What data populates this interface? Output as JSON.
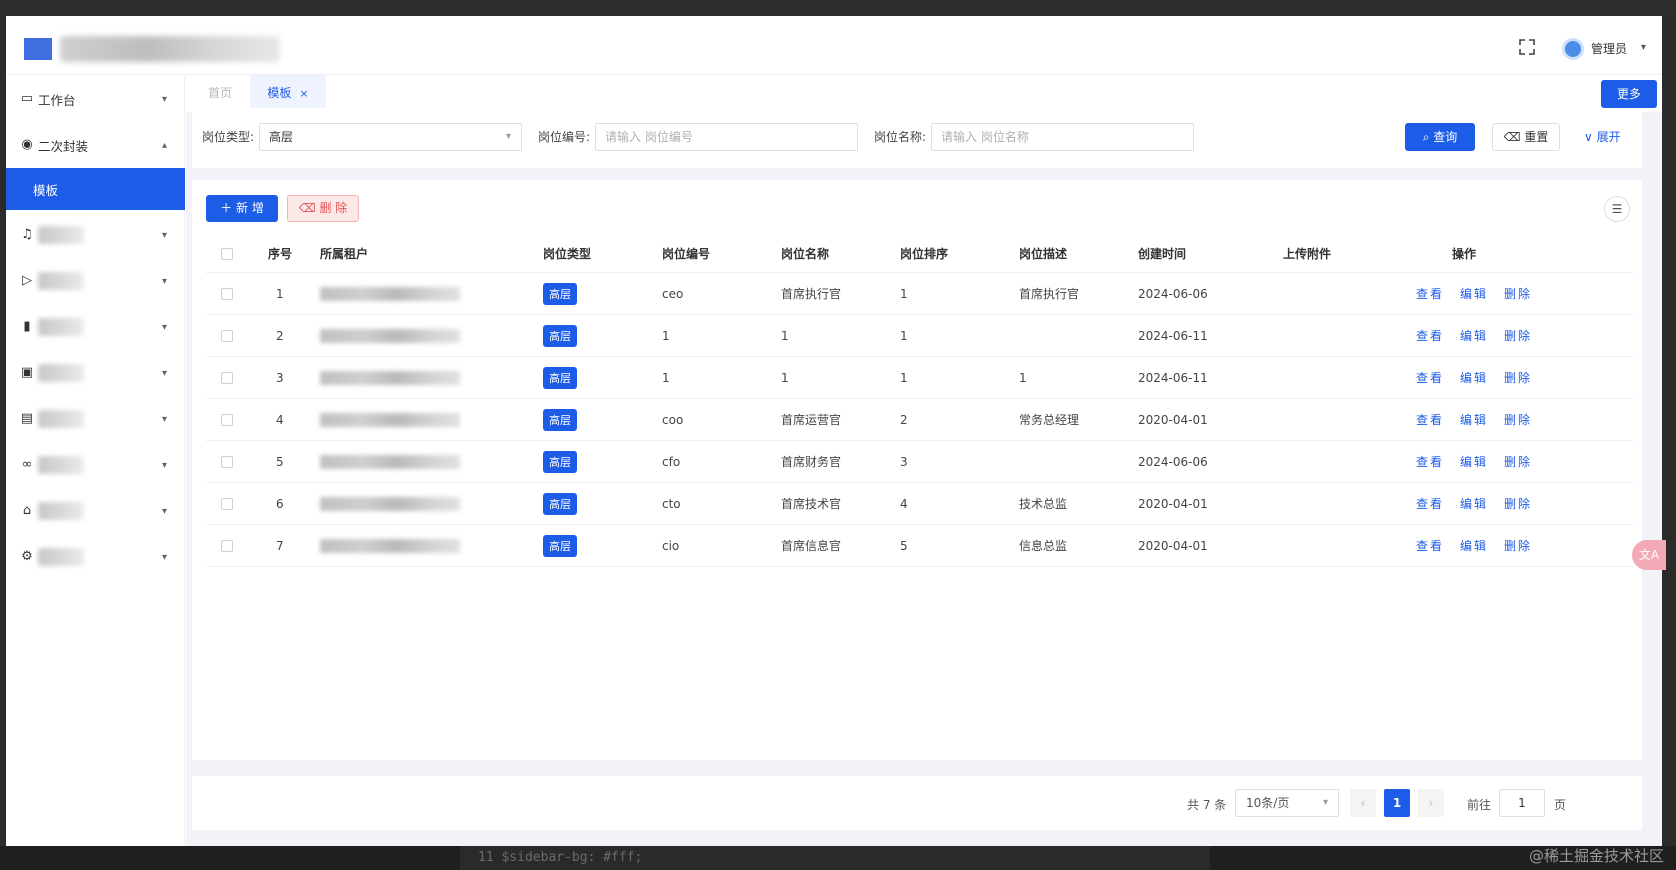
{
  "header": {
    "user_name": "管理员"
  },
  "sidebar": {
    "items": [
      {
        "label": "工作台",
        "icon": "monitor-icon"
      },
      {
        "label": "二次封装",
        "icon": "gauge-icon"
      },
      {
        "label": "模板"
      },
      {
        "icon": "bell-icon"
      },
      {
        "icon": "send-icon"
      },
      {
        "icon": "bar-chart-icon"
      },
      {
        "icon": "wallet-icon"
      },
      {
        "icon": "document-icon"
      },
      {
        "icon": "link-icon"
      },
      {
        "icon": "lock-icon"
      },
      {
        "icon": "gear-icon"
      }
    ]
  },
  "tabs": {
    "home": "首页",
    "current": "模板",
    "close": "×",
    "more": "更多"
  },
  "search": {
    "type_label": "岗位类型:",
    "type_value": "高层",
    "code_label": "岗位编号:",
    "code_placeholder": "请输入 岗位编号",
    "name_label": "岗位名称:",
    "name_placeholder": "请输入 岗位名称",
    "query": "查询",
    "reset": "重置",
    "expand": "展开"
  },
  "toolbar": {
    "add": "新 增",
    "delete": "删 除"
  },
  "table": {
    "headers": [
      "序号",
      "所属租户",
      "岗位类型",
      "岗位编号",
      "岗位名称",
      "岗位排序",
      "岗位描述",
      "创建时间",
      "上传附件",
      "操作"
    ],
    "actions": [
      "查看",
      "编辑",
      "删除"
    ],
    "rows": [
      {
        "no": "1",
        "type": "高层",
        "code": "ceo",
        "name": "首席执行官",
        "sort": "1",
        "desc": "首席执行官",
        "created": "2024-06-06"
      },
      {
        "no": "2",
        "type": "高层",
        "code": "1",
        "name": "1",
        "sort": "1",
        "desc": "",
        "created": "2024-06-11"
      },
      {
        "no": "3",
        "type": "高层",
        "code": "1",
        "name": "1",
        "sort": "1",
        "desc": "1",
        "created": "2024-06-11"
      },
      {
        "no": "4",
        "type": "高层",
        "code": "coo",
        "name": "首席运营官",
        "sort": "2",
        "desc": "常务总经理",
        "created": "2020-04-01"
      },
      {
        "no": "5",
        "type": "高层",
        "code": "cfo",
        "name": "首席财务官",
        "sort": "3",
        "desc": "",
        "created": "2024-06-06"
      },
      {
        "no": "6",
        "type": "高层",
        "code": "cto",
        "name": "首席技术官",
        "sort": "4",
        "desc": "技术总监",
        "created": "2020-04-01"
      },
      {
        "no": "7",
        "type": "高层",
        "code": "cio",
        "name": "首席信息官",
        "sort": "5",
        "desc": "信息总监",
        "created": "2020-04-01"
      }
    ]
  },
  "pagination": {
    "total": "共 7 条",
    "page_size": "10条/页",
    "current_page": "1",
    "goto_label": "前往",
    "goto_value": "1",
    "page_suffix": "页"
  },
  "watermark": "@稀土掘金技术社区",
  "backdrop_code": "11    $sidebar-bg: #fff;"
}
